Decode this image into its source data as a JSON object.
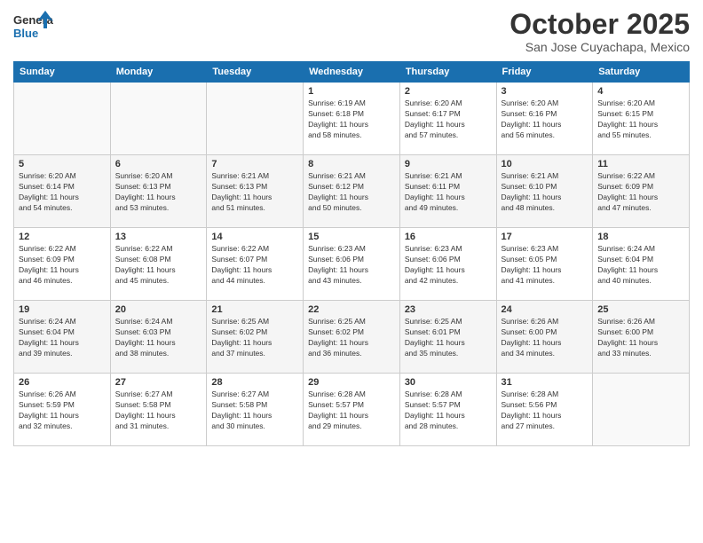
{
  "header": {
    "logo_general": "General",
    "logo_blue": "Blue",
    "month_title": "October 2025",
    "location": "San Jose Cuyachapa, Mexico"
  },
  "days_of_week": [
    "Sunday",
    "Monday",
    "Tuesday",
    "Wednesday",
    "Thursday",
    "Friday",
    "Saturday"
  ],
  "weeks": [
    [
      {
        "day": "",
        "info": ""
      },
      {
        "day": "",
        "info": ""
      },
      {
        "day": "",
        "info": ""
      },
      {
        "day": "1",
        "info": "Sunrise: 6:19 AM\nSunset: 6:18 PM\nDaylight: 11 hours\nand 58 minutes."
      },
      {
        "day": "2",
        "info": "Sunrise: 6:20 AM\nSunset: 6:17 PM\nDaylight: 11 hours\nand 57 minutes."
      },
      {
        "day": "3",
        "info": "Sunrise: 6:20 AM\nSunset: 6:16 PM\nDaylight: 11 hours\nand 56 minutes."
      },
      {
        "day": "4",
        "info": "Sunrise: 6:20 AM\nSunset: 6:15 PM\nDaylight: 11 hours\nand 55 minutes."
      }
    ],
    [
      {
        "day": "5",
        "info": "Sunrise: 6:20 AM\nSunset: 6:14 PM\nDaylight: 11 hours\nand 54 minutes."
      },
      {
        "day": "6",
        "info": "Sunrise: 6:20 AM\nSunset: 6:13 PM\nDaylight: 11 hours\nand 53 minutes."
      },
      {
        "day": "7",
        "info": "Sunrise: 6:21 AM\nSunset: 6:13 PM\nDaylight: 11 hours\nand 51 minutes."
      },
      {
        "day": "8",
        "info": "Sunrise: 6:21 AM\nSunset: 6:12 PM\nDaylight: 11 hours\nand 50 minutes."
      },
      {
        "day": "9",
        "info": "Sunrise: 6:21 AM\nSunset: 6:11 PM\nDaylight: 11 hours\nand 49 minutes."
      },
      {
        "day": "10",
        "info": "Sunrise: 6:21 AM\nSunset: 6:10 PM\nDaylight: 11 hours\nand 48 minutes."
      },
      {
        "day": "11",
        "info": "Sunrise: 6:22 AM\nSunset: 6:09 PM\nDaylight: 11 hours\nand 47 minutes."
      }
    ],
    [
      {
        "day": "12",
        "info": "Sunrise: 6:22 AM\nSunset: 6:09 PM\nDaylight: 11 hours\nand 46 minutes."
      },
      {
        "day": "13",
        "info": "Sunrise: 6:22 AM\nSunset: 6:08 PM\nDaylight: 11 hours\nand 45 minutes."
      },
      {
        "day": "14",
        "info": "Sunrise: 6:22 AM\nSunset: 6:07 PM\nDaylight: 11 hours\nand 44 minutes."
      },
      {
        "day": "15",
        "info": "Sunrise: 6:23 AM\nSunset: 6:06 PM\nDaylight: 11 hours\nand 43 minutes."
      },
      {
        "day": "16",
        "info": "Sunrise: 6:23 AM\nSunset: 6:06 PM\nDaylight: 11 hours\nand 42 minutes."
      },
      {
        "day": "17",
        "info": "Sunrise: 6:23 AM\nSunset: 6:05 PM\nDaylight: 11 hours\nand 41 minutes."
      },
      {
        "day": "18",
        "info": "Sunrise: 6:24 AM\nSunset: 6:04 PM\nDaylight: 11 hours\nand 40 minutes."
      }
    ],
    [
      {
        "day": "19",
        "info": "Sunrise: 6:24 AM\nSunset: 6:04 PM\nDaylight: 11 hours\nand 39 minutes."
      },
      {
        "day": "20",
        "info": "Sunrise: 6:24 AM\nSunset: 6:03 PM\nDaylight: 11 hours\nand 38 minutes."
      },
      {
        "day": "21",
        "info": "Sunrise: 6:25 AM\nSunset: 6:02 PM\nDaylight: 11 hours\nand 37 minutes."
      },
      {
        "day": "22",
        "info": "Sunrise: 6:25 AM\nSunset: 6:02 PM\nDaylight: 11 hours\nand 36 minutes."
      },
      {
        "day": "23",
        "info": "Sunrise: 6:25 AM\nSunset: 6:01 PM\nDaylight: 11 hours\nand 35 minutes."
      },
      {
        "day": "24",
        "info": "Sunrise: 6:26 AM\nSunset: 6:00 PM\nDaylight: 11 hours\nand 34 minutes."
      },
      {
        "day": "25",
        "info": "Sunrise: 6:26 AM\nSunset: 6:00 PM\nDaylight: 11 hours\nand 33 minutes."
      }
    ],
    [
      {
        "day": "26",
        "info": "Sunrise: 6:26 AM\nSunset: 5:59 PM\nDaylight: 11 hours\nand 32 minutes."
      },
      {
        "day": "27",
        "info": "Sunrise: 6:27 AM\nSunset: 5:58 PM\nDaylight: 11 hours\nand 31 minutes."
      },
      {
        "day": "28",
        "info": "Sunrise: 6:27 AM\nSunset: 5:58 PM\nDaylight: 11 hours\nand 30 minutes."
      },
      {
        "day": "29",
        "info": "Sunrise: 6:28 AM\nSunset: 5:57 PM\nDaylight: 11 hours\nand 29 minutes."
      },
      {
        "day": "30",
        "info": "Sunrise: 6:28 AM\nSunset: 5:57 PM\nDaylight: 11 hours\nand 28 minutes."
      },
      {
        "day": "31",
        "info": "Sunrise: 6:28 AM\nSunset: 5:56 PM\nDaylight: 11 hours\nand 27 minutes."
      },
      {
        "day": "",
        "info": ""
      }
    ]
  ]
}
